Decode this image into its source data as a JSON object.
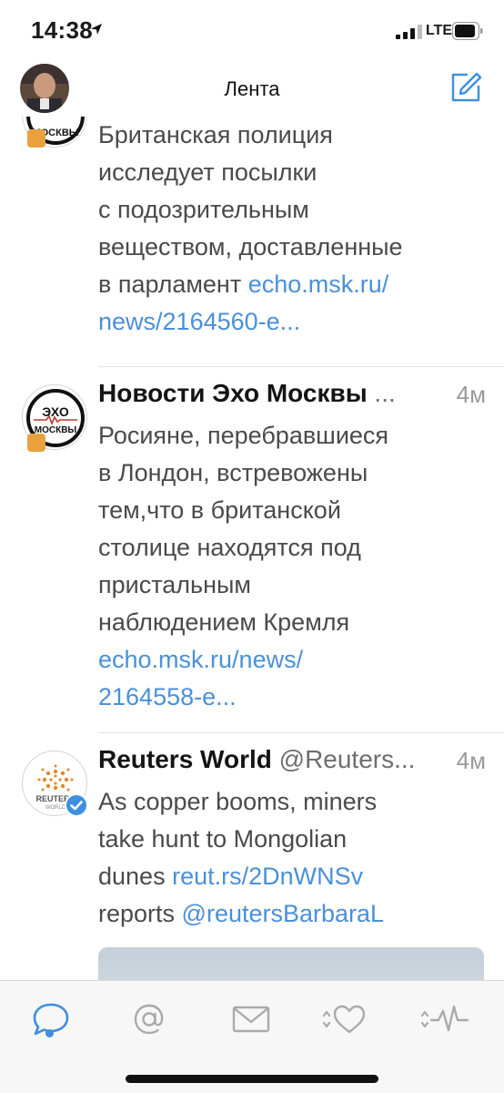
{
  "status_bar": {
    "time": "14:38",
    "network": "LTE"
  },
  "nav": {
    "title": "Лента",
    "compose_icon": "compose-icon",
    "avatar_icon": "profile-avatar"
  },
  "tweets": [
    {
      "lines": [
        "Британская полиция",
        "исследует посылки",
        "с подозрительным",
        "веществом, доставленные"
      ],
      "line_link_prefix": "в  парламент ",
      "link_part1": "echo.msk.ru/",
      "link_part2": "news/2164560-e..."
    },
    {
      "name": "Новости Эхо Москвы",
      "handle": " ...",
      "time": "4м",
      "lines": [
        "Росияне, перебравшиеся",
        "в Лондон, встревожены",
        "тем,что в британской",
        "столице находятся под",
        "пристальным",
        "наблюдением Кремля"
      ],
      "link_part1": "echo.msk.ru/news/",
      "link_part2": "2164558-e...",
      "avatar_text_top": "ЭХО",
      "avatar_text_bottom": "МОСКВЫ"
    },
    {
      "name": "Reuters World",
      "handle": " @Reuters...",
      "time": "4м",
      "line1": "As copper booms, miners",
      "line2": "take hunt to Mongolian",
      "line3_text": "dunes ",
      "line3_link": "reut.rs/2DnWNSv",
      "line4_text": "reports ",
      "line4_link": "@reutersBarbaraL",
      "avatar_text": "REUTERS",
      "avatar_sub": "WORLD"
    }
  ],
  "partial_avatar_text": "МОСКВЫ",
  "tabs": [
    {
      "name": "timeline",
      "icon": "speech-bubble-icon",
      "active": true
    },
    {
      "name": "mentions",
      "icon": "at-sign-icon",
      "active": false
    },
    {
      "name": "messages",
      "icon": "envelope-icon",
      "active": false
    },
    {
      "name": "likes",
      "icon": "heart-icon",
      "active": false
    },
    {
      "name": "activity",
      "icon": "activity-icon",
      "active": false
    }
  ],
  "colors": {
    "accent": "#3d8fe0",
    "link": "#4a90d9",
    "divider": "#e3e3e3"
  }
}
